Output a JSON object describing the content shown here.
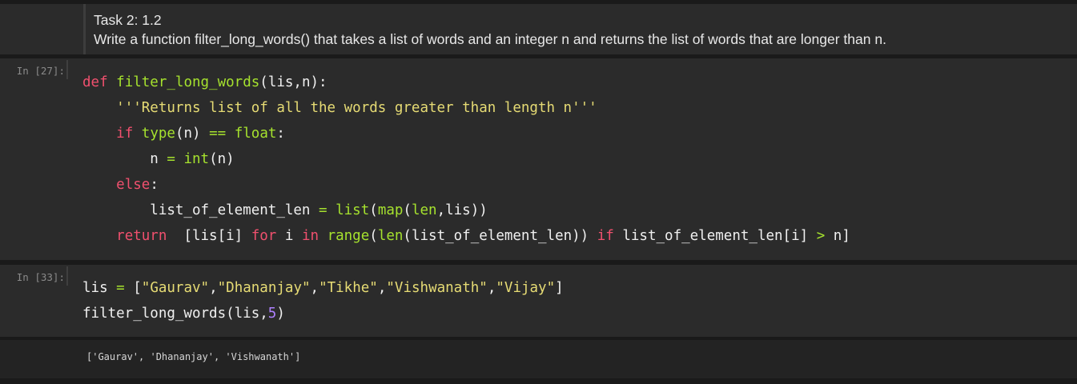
{
  "markdown": {
    "title": "Task 2: 1.2",
    "description": "Write a function filter_long_words() that takes a list of words and an integer n and returns the list of words that are longer than n."
  },
  "cells": [
    {
      "prompt": "In [27]:",
      "lines": [
        [
          [
            "kw",
            "def"
          ],
          [
            "pl",
            " "
          ],
          [
            "fn",
            "filter_long_words"
          ],
          [
            "pl",
            "(lis,n):"
          ]
        ],
        [
          [
            "pl",
            "    "
          ],
          [
            "str",
            "'''Returns list of all the words greater than length n'''"
          ]
        ],
        [
          [
            "pl",
            "    "
          ],
          [
            "kw",
            "if"
          ],
          [
            "pl",
            " "
          ],
          [
            "bi",
            "type"
          ],
          [
            "pl",
            "(n) "
          ],
          [
            "op",
            "=="
          ],
          [
            "pl",
            " "
          ],
          [
            "bi",
            "float"
          ],
          [
            "pl",
            ":"
          ]
        ],
        [
          [
            "pl",
            "        n "
          ],
          [
            "op",
            "="
          ],
          [
            "pl",
            " "
          ],
          [
            "bi",
            "int"
          ],
          [
            "pl",
            "(n)"
          ]
        ],
        [
          [
            "pl",
            "    "
          ],
          [
            "kw",
            "else"
          ],
          [
            "pl",
            ":"
          ]
        ],
        [
          [
            "pl",
            "        list_of_element_len "
          ],
          [
            "op",
            "="
          ],
          [
            "pl",
            " "
          ],
          [
            "bi",
            "list"
          ],
          [
            "pl",
            "("
          ],
          [
            "bi",
            "map"
          ],
          [
            "pl",
            "("
          ],
          [
            "bi",
            "len"
          ],
          [
            "pl",
            ",lis))"
          ]
        ],
        [
          [
            "pl",
            "    "
          ],
          [
            "kw",
            "return"
          ],
          [
            "pl",
            "  [lis[i] "
          ],
          [
            "kw",
            "for"
          ],
          [
            "pl",
            " i "
          ],
          [
            "kw",
            "in"
          ],
          [
            "pl",
            " "
          ],
          [
            "bi",
            "range"
          ],
          [
            "pl",
            "("
          ],
          [
            "bi",
            "len"
          ],
          [
            "pl",
            "(list_of_element_len)) "
          ],
          [
            "kw",
            "if"
          ],
          [
            "pl",
            " list_of_element_len[i] "
          ],
          [
            "op",
            ">"
          ],
          [
            "pl",
            " n]"
          ]
        ]
      ]
    },
    {
      "prompt": "In [33]:",
      "lines": [
        [
          [
            "pl",
            "lis "
          ],
          [
            "op",
            "="
          ],
          [
            "pl",
            " ["
          ],
          [
            "str",
            "\"Gaurav\""
          ],
          [
            "pl",
            ","
          ],
          [
            "str",
            "\"Dhananjay\""
          ],
          [
            "pl",
            ","
          ],
          [
            "str",
            "\"Tikhe\""
          ],
          [
            "pl",
            ","
          ],
          [
            "str",
            "\"Vishwanath\""
          ],
          [
            "pl",
            ","
          ],
          [
            "str",
            "\"Vijay\""
          ],
          [
            "pl",
            "]"
          ]
        ],
        [
          [
            "pl",
            "filter_long_words(lis,"
          ],
          [
            "num",
            "5"
          ],
          [
            "pl",
            ")"
          ]
        ]
      ]
    }
  ],
  "output": {
    "text": "['Gaurav', 'Dhananjay', 'Vishwanath']"
  }
}
